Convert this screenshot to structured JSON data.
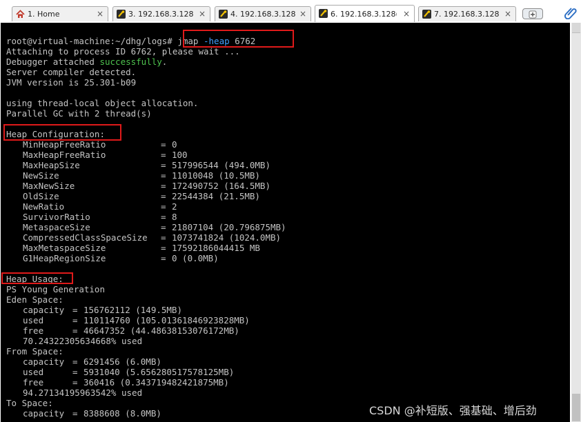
{
  "tabs": [
    {
      "label": "1. Home",
      "icon": "home-icon"
    },
    {
      "label": "3. 192.168.3.128 (",
      "icon": "terminal-icon"
    },
    {
      "label": "4. 192.168.3.128 (",
      "icon": "terminal-icon"
    },
    {
      "label": "6. 192.168.3.128(",
      "icon": "terminal-icon",
      "active": true
    },
    {
      "label": "7. 192.168.3.128 (",
      "icon": "terminal-icon"
    }
  ],
  "tab_close_glyph": "×",
  "terminal": {
    "prompt": "root@virtual-machine:~/dhg/logs# ",
    "command": "jmap",
    "option": "-heap",
    "pid": "6762",
    "attaching": "Attaching to process ID 6762, please wait ...",
    "debugger_prefix": "Debugger attached ",
    "debugger_status": "successfully",
    "debugger_suffix": ".",
    "compiler": "Server compiler detected.",
    "jvm_version": "JVM version is 25.301-b09",
    "tlab": "using thread-local object allocation.",
    "gc": "Parallel GC with 2 thread(s)",
    "heap_config_title": "Heap Configuration:",
    "heap_config": [
      {
        "name": "MinHeapFreeRatio",
        "value": "0"
      },
      {
        "name": "MaxHeapFreeRatio",
        "value": "100"
      },
      {
        "name": "MaxHeapSize",
        "value": "517996544 (494.0MB)"
      },
      {
        "name": "NewSize",
        "value": "11010048 (10.5MB)"
      },
      {
        "name": "MaxNewSize",
        "value": "172490752 (164.5MB)"
      },
      {
        "name": "OldSize",
        "value": "22544384 (21.5MB)"
      },
      {
        "name": "NewRatio",
        "value": "2"
      },
      {
        "name": "SurvivorRatio",
        "value": "8"
      },
      {
        "name": "MetaspaceSize",
        "value": "21807104 (20.796875MB)"
      },
      {
        "name": "CompressedClassSpaceSize",
        "value": "1073741824 (1024.0MB)"
      },
      {
        "name": "MaxMetaspaceSize",
        "value": "17592186044415 MB"
      },
      {
        "name": "G1HeapRegionSize",
        "value": "0 (0.0MB)"
      }
    ],
    "heap_usage_title": "Heap Usage:",
    "young_gen": "PS Young Generation",
    "eden_title": "Eden Space:",
    "eden": [
      {
        "name": "capacity",
        "value": "156762112 (149.5MB)"
      },
      {
        "name": "used",
        "value": "110114760 (105.01361846923828MB)"
      },
      {
        "name": "free",
        "value": "46647352 (44.48638153076172MB)"
      }
    ],
    "eden_pct": "70.24322305634668% used",
    "from_title": "From Space:",
    "from": [
      {
        "name": "capacity",
        "value": "6291456 (6.0MB)"
      },
      {
        "name": "used",
        "value": "5931040 (5.656280517578125MB)"
      },
      {
        "name": "free",
        "value": "360416 (0.343719482421875MB)"
      }
    ],
    "from_pct": "94.27134195963542% used",
    "to_title": "To Space:",
    "to": [
      {
        "name": "capacity",
        "value": "8388608 (8.0MB)"
      }
    ]
  },
  "watermark": "CSDN @补短版、强基础、增后劲",
  "colors": {
    "highlight_box": "#e01a1a",
    "success_green": "#4ec34e",
    "option_blue": "#43a0ff"
  }
}
